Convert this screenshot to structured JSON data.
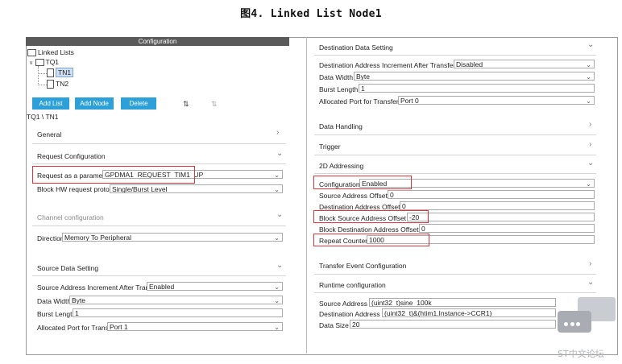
{
  "figure_title": "图4.    Linked List Node1",
  "left": {
    "header": "Configuration",
    "tree": {
      "root": "Linked Lists",
      "queue": "TQ1",
      "nodes": [
        "TN1",
        "TN2"
      ]
    },
    "buttons": {
      "add_list": "Add List",
      "add_node": "Add Node",
      "delete": "Delete"
    },
    "path": "TQ1 \\ TN1",
    "general": "General",
    "request_configuration": "Request Configuration",
    "request_param_label": "Request as a parameter",
    "request_param_value": "GPDMA1_REQUEST_TIM1_UP",
    "block_hw_label": "Block HW request protocol",
    "block_hw_value": "Single/Burst Level",
    "channel_configuration": "Channel configuration",
    "direction_label": "Direction",
    "direction_value": "Memory To Peripheral",
    "source_data_setting": "Source Data Setting",
    "src_inc_label": "Source Address Increment After Transfer",
    "src_inc_value": "Enabled",
    "data_width_label": "Data Width",
    "data_width_value": "Byte",
    "burst_length_label": "Burst Length",
    "burst_length_value": "1",
    "alloc_port_label": "Allocated Port for Transfer",
    "alloc_port_value": "Port 1"
  },
  "right": {
    "destination_data_setting": "Destination Data Setting",
    "dst_inc_label": "Destination Address Increment After Transfer",
    "dst_inc_value": "Disabled",
    "data_width_label": "Data Width",
    "data_width_value": "Byte",
    "burst_length_label": "Burst Length",
    "burst_length_value": "1",
    "alloc_port_label": "Allocated Port for Transfer",
    "alloc_port_value": "Port 0",
    "data_handling": "Data Handling",
    "trigger": "Trigger",
    "addressing_2d": "2D Addressing",
    "configuration_label": "Configuration",
    "configuration_value": "Enabled",
    "src_offset_label": "Source Address Offset",
    "src_offset_value": "0",
    "dst_offset_label": "Destination Address Offset",
    "dst_offset_value": "0",
    "block_src_offset_label": "Block Source Address Offset",
    "block_src_offset_value": "-20",
    "block_dst_offset_label": "Block Destination Address Offset",
    "block_dst_offset_value": "0",
    "repeat_counter_label": "Repeat Counter",
    "repeat_counter_value": "1000",
    "transfer_event_configuration": "Transfer Event Configuration",
    "runtime_configuration": "Runtime configuration",
    "source_address_label": "Source Address",
    "source_address_value": "(uint32_t)sine_100k",
    "destination_address_label": "Destination Address",
    "destination_address_value": "(uint32_t)&(htim1.Instance->CCR1)",
    "data_size_label": "Data Size",
    "data_size_value": "20"
  },
  "watermark": "ST中文论坛",
  "colors": {
    "button_blue": "#2d9fd9",
    "highlight_red": "#e0343b",
    "header_grey": "#5a5a5a"
  }
}
